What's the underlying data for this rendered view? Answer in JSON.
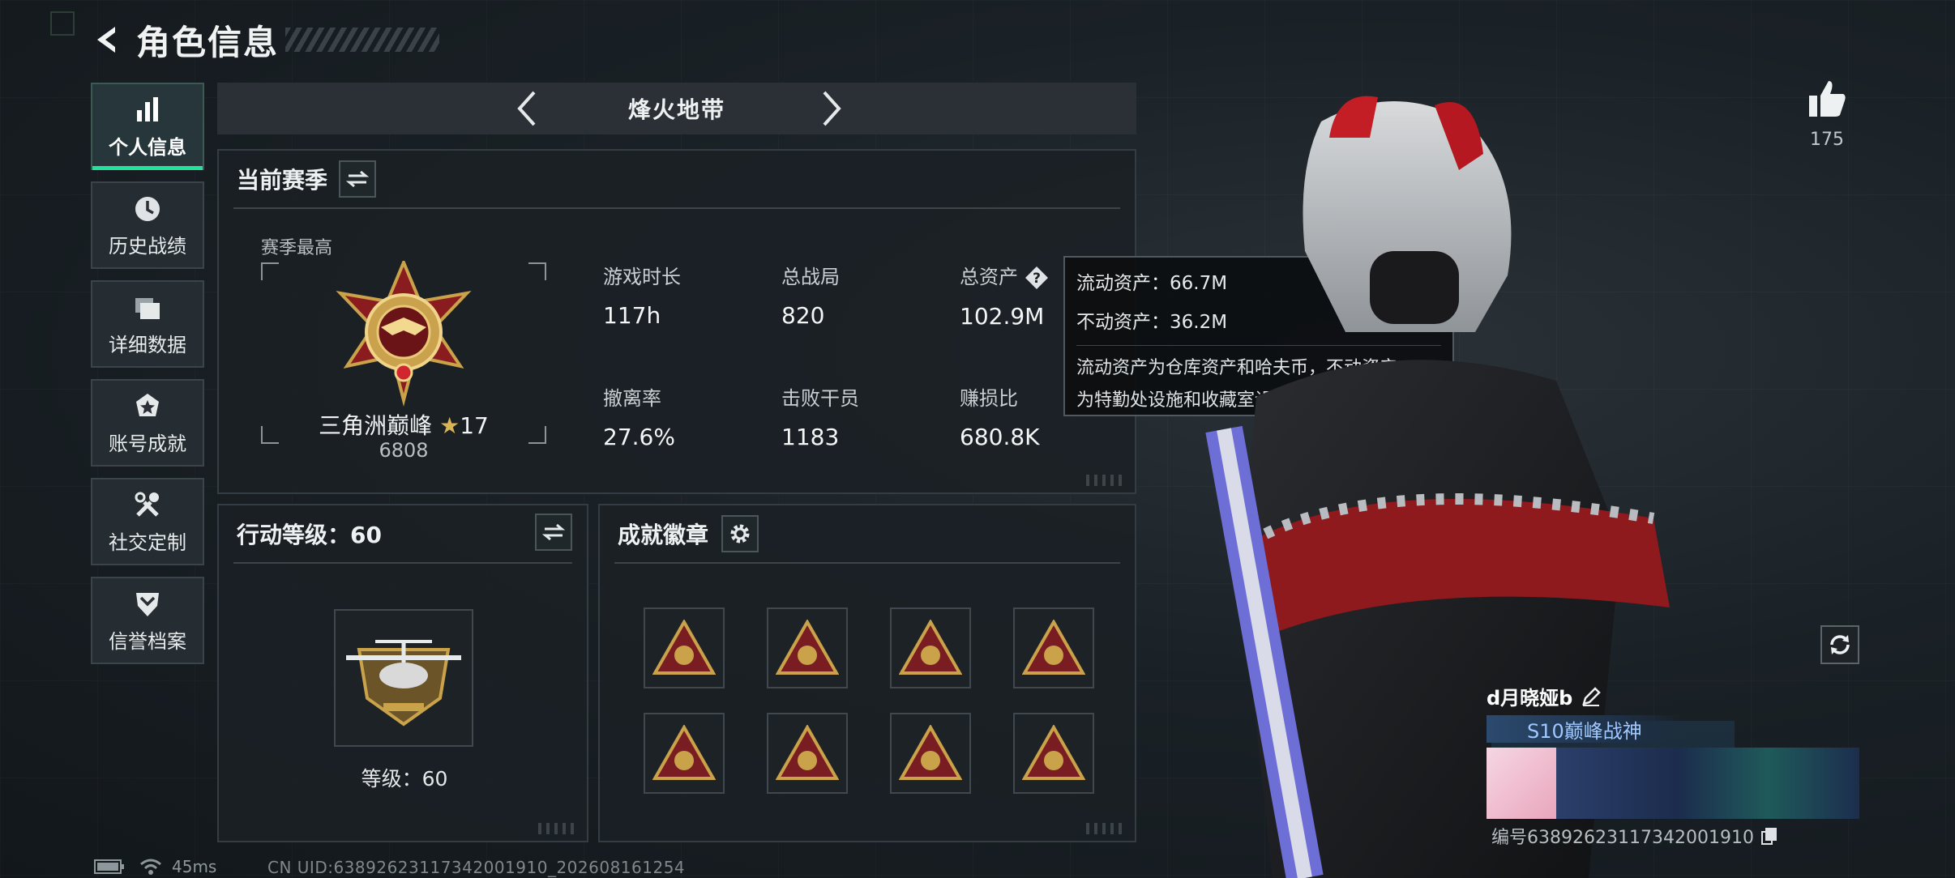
{
  "header": {
    "title": "角色信息"
  },
  "sidebar": {
    "items": [
      {
        "label": "个人信息",
        "icon": "bar-chart-icon",
        "active": true
      },
      {
        "label": "历史战绩",
        "icon": "clock-history-icon",
        "active": false
      },
      {
        "label": "详细数据",
        "icon": "folder-stack-icon",
        "active": false
      },
      {
        "label": "账号成就",
        "icon": "achievement-star-icon",
        "active": false
      },
      {
        "label": "社交定制",
        "icon": "tools-icon",
        "active": false
      },
      {
        "label": "信誉档案",
        "icon": "shield-chevron-icon",
        "active": false
      }
    ]
  },
  "mode": {
    "title": "烽火地带"
  },
  "season": {
    "title": "当前赛季",
    "best_label": "赛季最高",
    "rank_name": "三角洲巅峰",
    "rank_stars": "17",
    "rank_score": "6808",
    "stats": [
      {
        "key": "游戏时长",
        "value": "117h"
      },
      {
        "key": "总战局",
        "value": "820"
      },
      {
        "key": "总资产",
        "value": "102.9M"
      },
      {
        "key": "撤离率",
        "value": "27.6%"
      },
      {
        "key": "击败干员",
        "value": "1183"
      },
      {
        "key": "赚损比",
        "value": "680.8K"
      }
    ]
  },
  "tooltip": {
    "liquid": "流动资产：66.7M",
    "fixed": "不动资产：36.2M",
    "desc_line1": "流动资产为仓库资产和哈夫币，不动资产",
    "desc_line2": "为特勤处设施和收藏室设施"
  },
  "action_level": {
    "title": "行动等级：60",
    "level_text": "等级：60"
  },
  "badges": {
    "title": "成就徽章",
    "items": [
      "badge-1",
      "badge-2",
      "badge-3",
      "badge-4",
      "badge-5",
      "badge-6",
      "badge-7",
      "badge-8"
    ]
  },
  "likes": {
    "count": "175"
  },
  "player": {
    "name": "d月晓娅b",
    "title": "S10巅峰战神",
    "id_text": "编号6389262311734200191​0"
  },
  "status": {
    "ping": "45ms",
    "uid": "CN UID:6389262311734200191​0_202608161254"
  },
  "colors": {
    "accent": "#22e39b",
    "gold": "#c9a24a",
    "badge_red": "#7a1d22"
  }
}
